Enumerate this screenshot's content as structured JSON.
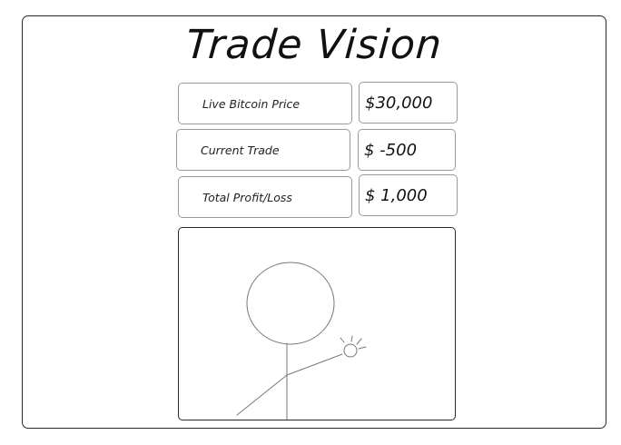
{
  "header": {
    "title": "Trade Vision"
  },
  "stats": [
    {
      "label": "Live Bitcoin Price",
      "value": "$30,000"
    },
    {
      "label": "Current Trade",
      "value": "$ -500"
    },
    {
      "label": "Total Profit/Loss",
      "value": "$ 1,000"
    }
  ],
  "illustration": {
    "icon": "stick-figure-icon"
  }
}
